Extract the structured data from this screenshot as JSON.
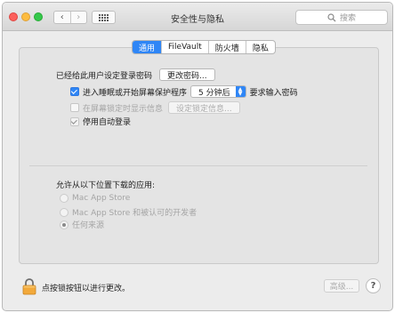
{
  "window": {
    "title": "安全性与隐私",
    "search_placeholder": "搜索",
    "nav_back": "‹",
    "nav_forward": "›"
  },
  "tabs": [
    {
      "label": "通用",
      "active": true
    },
    {
      "label": "FileVault",
      "active": false
    },
    {
      "label": "防火墙",
      "active": false
    },
    {
      "label": "隐私",
      "active": false
    }
  ],
  "general": {
    "password_set_label": "已经给此用户设定登录密码",
    "change_password_button": "更改密码...",
    "require_password": {
      "checked": true,
      "label_before": "进入睡眠或开始屏幕保护程序",
      "delay_value": "5 分钟后",
      "label_after": "要求输入密码"
    },
    "lock_message": {
      "checked": false,
      "label": "在屏幕锁定时显示信息",
      "button": "设定锁定信息..."
    },
    "disable_auto_login": {
      "checked": true,
      "label": "停用自动登录"
    }
  },
  "downloads": {
    "heading": "允许从以下位置下载的应用:",
    "options": [
      {
        "label": "Mac App Store",
        "selected": false
      },
      {
        "label": "Mac App Store 和被认可的开发者",
        "selected": false
      },
      {
        "label": "任何来源",
        "selected": true
      }
    ]
  },
  "footer": {
    "lock_text": "点按锁按钮以进行更改。",
    "advanced_button": "高级...",
    "help_button": "?"
  },
  "colors": {
    "accent": "#2f86f6",
    "lock_body": "#f2a93b"
  }
}
